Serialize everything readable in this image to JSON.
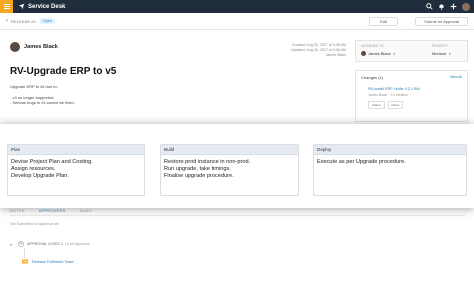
{
  "app": {
    "title": "Service Desk"
  },
  "colors": {
    "topbar": "#1f2d3d",
    "accent": "#f5a623",
    "link": "#2a7ab0"
  },
  "header": {
    "back_label": "‹",
    "breadcrumb": "RELEASE #1",
    "status": "Open",
    "edit_label": "Edit",
    "submit_label": "Submit for Approval"
  },
  "record": {
    "author": "James Black",
    "meta_line1": "Created: Aug 30, 2017 at 9:38 AM",
    "meta_line2": "Updated: Aug 30, 2017 at 9:38 AM",
    "meta_line3": "James Black",
    "title": "RV-Upgrade ERP to v5",
    "desc_line1": "Upgrade ERP to v5 due to:",
    "desc_line2": "- v3 no longer supported.",
    "desc_line3": "- Serious bugs in v3 cannot be fixed."
  },
  "side": {
    "assigned_label": "ASSIGNED TO",
    "assigned_value": "James Black",
    "priority_label": "PRIORITY",
    "priority_value": "Medium",
    "changes_label": "Changes (1)",
    "view_all": "View All",
    "change_title": "RV-install ERP Hotfix 4.2.1 Bld",
    "change_sub": "James Black · 1:1 Medium",
    "tag1": "Attach",
    "tag2": "Notes"
  },
  "phases": [
    {
      "title": "Plan",
      "lines": [
        "Devise Project Plan and Costing.",
        "Assign resources.",
        "Develop Upgrade Plan."
      ]
    },
    {
      "title": "Build",
      "lines": [
        "Restore prod instance in non-prod.",
        "Run upgrade, take timings.",
        "Finalise upgrade procedure."
      ]
    },
    {
      "title": "Deploy",
      "lines": [
        "Execute as per Upgrade procedure."
      ]
    }
  ],
  "tabs": {
    "notes": "NOTES",
    "approvers": "APPROVERS",
    "audit": "AUDIT"
  },
  "approvals": {
    "not_submitted": "Not Submitted for Approval yet",
    "level_label": "APPROVAL LEVEL 1",
    "level_count": "(1) All approvers",
    "team": "Release Fulfilment Team"
  }
}
